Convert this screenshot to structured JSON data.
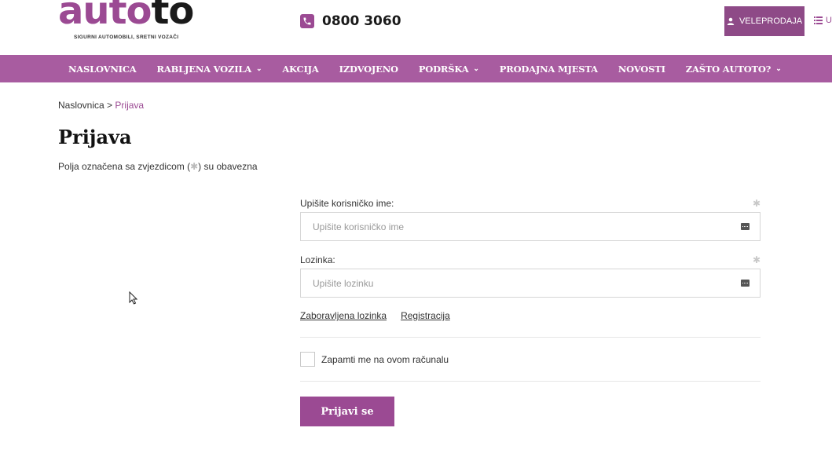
{
  "header": {
    "logo_part1": "auto",
    "logo_part2": "to",
    "logo_tagline": "SIGURNI AUTOMOBILI, SRETNI VOZAČI",
    "phone": "0800 3060",
    "wholesale_label": "VELEPRODAJA",
    "more_label": "U",
    "brand_color": "#9b4a93"
  },
  "nav": {
    "items": [
      {
        "label": "NASLOVNICA"
      },
      {
        "label": "RABLJENA VOZILA"
      },
      {
        "label": "AKCIJA"
      },
      {
        "label": "IZDVOJENO"
      },
      {
        "label": "PODRŠKA"
      },
      {
        "label": "PRODAJNA MJESTA"
      },
      {
        "label": "NOVOSTI"
      },
      {
        "label": "ZAŠTO AUTOTO?"
      }
    ],
    "bg_color": "#a85ca0"
  },
  "breadcrumb": {
    "home": "Naslovnica",
    "separator": ">",
    "current": "Prijava"
  },
  "page": {
    "title": "Prijava",
    "note_before": "Polja označena sa zvjezdicom (",
    "note_star": "✱",
    "note_after": ") su obavezna"
  },
  "form": {
    "username_label": "Upišite korisničko ime:",
    "username_placeholder": "Upišite korisničko ime",
    "username_value": "",
    "password_label": "Lozinka:",
    "password_placeholder": "Upišite lozinku",
    "password_value": "",
    "required_star": "✱",
    "forgot_link": "Zaboravljena lozinka",
    "register_link": "Registracija",
    "remember_label": "Zapamti me na ovom računalu",
    "submit_label": "Prijavi se"
  }
}
